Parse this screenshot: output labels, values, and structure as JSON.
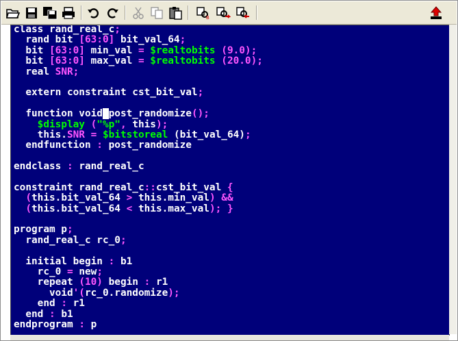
{
  "toolbar": {
    "buttons": [
      {
        "name": "open-file-button",
        "icon": "open-folder-icon"
      },
      {
        "name": "save-button",
        "icon": "floppy-disk-icon"
      },
      {
        "name": "save-all-button",
        "icon": "save-all-icon"
      },
      {
        "name": "print-button",
        "icon": "printer-icon"
      },
      {
        "name": "undo-button",
        "icon": "undo-icon"
      },
      {
        "name": "redo-button",
        "icon": "redo-icon"
      },
      {
        "name": "cut-button",
        "icon": "scissors-icon"
      },
      {
        "name": "copy-button",
        "icon": "copy-icon"
      },
      {
        "name": "paste-button",
        "icon": "clipboard-icon"
      },
      {
        "name": "replace-button",
        "icon": "find-replace-icon"
      },
      {
        "name": "find-next-button",
        "icon": "find-next-icon"
      },
      {
        "name": "find-prev-button",
        "icon": "find-previous-icon"
      },
      {
        "name": "upload-button",
        "icon": "upload-arrow-icon"
      }
    ]
  },
  "editor": {
    "colors": {
      "background": "#00007a",
      "text": "#ffffff",
      "operator": "#ff55ff",
      "system_task": "#00ff00",
      "cursor": "#ffffff"
    },
    "lines": [
      [
        {
          "t": "class rand_real_c",
          "c": "kw"
        },
        {
          "t": ";",
          "c": "op"
        }
      ],
      [
        {
          "t": "  rand bit ",
          "c": "kw"
        },
        {
          "t": "[63:0]",
          "c": "op"
        },
        {
          "t": " bit_val_64",
          "c": "kw"
        },
        {
          "t": ";",
          "c": "op"
        }
      ],
      [
        {
          "t": "  bit ",
          "c": "kw"
        },
        {
          "t": "[63:0]",
          "c": "op"
        },
        {
          "t": " min_val ",
          "c": "kw"
        },
        {
          "t": "=",
          "c": "op"
        },
        {
          "t": " ",
          "c": "kw"
        },
        {
          "t": "$realtobits",
          "c": "sys"
        },
        {
          "t": " ",
          "c": "kw"
        },
        {
          "t": "(9.0);",
          "c": "op"
        }
      ],
      [
        {
          "t": "  bit ",
          "c": "kw"
        },
        {
          "t": "[63:0]",
          "c": "op"
        },
        {
          "t": " max_val ",
          "c": "kw"
        },
        {
          "t": "=",
          "c": "op"
        },
        {
          "t": " ",
          "c": "kw"
        },
        {
          "t": "$realtobits",
          "c": "sys"
        },
        {
          "t": " ",
          "c": "kw"
        },
        {
          "t": "(20.0);",
          "c": "op"
        }
      ],
      [
        {
          "t": "  real ",
          "c": "kw"
        },
        {
          "t": "SNR;",
          "c": "op"
        }
      ],
      [
        {
          "t": "",
          "c": "kw"
        }
      ],
      [
        {
          "t": "  extern constraint cst_bit_val",
          "c": "kw"
        },
        {
          "t": ";",
          "c": "op"
        }
      ],
      [
        {
          "t": "",
          "c": "kw"
        }
      ],
      [
        {
          "t": "  function void",
          "c": "kw"
        },
        {
          "t": " ",
          "c": "cursor"
        },
        {
          "t": "post_randomize",
          "c": "kw"
        },
        {
          "t": "();",
          "c": "op"
        }
      ],
      [
        {
          "t": "    ",
          "c": "kw"
        },
        {
          "t": "$display",
          "c": "sys"
        },
        {
          "t": " (",
          "c": "op"
        },
        {
          "t": "\"%p\"",
          "c": "str"
        },
        {
          "t": ", ",
          "c": "op"
        },
        {
          "t": "this",
          "c": "kw"
        },
        {
          "t": ");",
          "c": "op"
        }
      ],
      [
        {
          "t": "    this.",
          "c": "kw"
        },
        {
          "t": "SNR",
          "c": "op"
        },
        {
          "t": " ",
          "c": "kw"
        },
        {
          "t": "=",
          "c": "op"
        },
        {
          "t": " ",
          "c": "kw"
        },
        {
          "t": "$bitstoreal",
          "c": "sys"
        },
        {
          "t": " (bit_val_64)",
          "c": "kw"
        },
        {
          "t": ";",
          "c": "op"
        }
      ],
      [
        {
          "t": "  endfunction ",
          "c": "kw"
        },
        {
          "t": ":",
          "c": "op"
        },
        {
          "t": " post_randomize",
          "c": "kw"
        }
      ],
      [
        {
          "t": "",
          "c": "kw"
        }
      ],
      [
        {
          "t": "endclass ",
          "c": "kw"
        },
        {
          "t": ":",
          "c": "op"
        },
        {
          "t": " rand_real_c",
          "c": "kw"
        }
      ],
      [
        {
          "t": "",
          "c": "kw"
        }
      ],
      [
        {
          "t": "constraint rand_real_c",
          "c": "kw"
        },
        {
          "t": "::",
          "c": "op"
        },
        {
          "t": "cst_bit_val ",
          "c": "kw"
        },
        {
          "t": "{",
          "c": "op"
        }
      ],
      [
        {
          "t": "  (",
          "c": "op"
        },
        {
          "t": "this.bit_val_64 ",
          "c": "kw"
        },
        {
          "t": ">",
          "c": "op"
        },
        {
          "t": " this.min_val",
          "c": "kw"
        },
        {
          "t": ")",
          "c": "op"
        },
        {
          "t": " ",
          "c": "kw"
        },
        {
          "t": "&&",
          "c": "op"
        }
      ],
      [
        {
          "t": "  (",
          "c": "op"
        },
        {
          "t": "this.bit_val_64 ",
          "c": "kw"
        },
        {
          "t": "<",
          "c": "op"
        },
        {
          "t": " this.max_val",
          "c": "kw"
        },
        {
          "t": ");",
          "c": "op"
        },
        {
          "t": " ",
          "c": "kw"
        },
        {
          "t": "}",
          "c": "op"
        }
      ],
      [
        {
          "t": "",
          "c": "kw"
        }
      ],
      [
        {
          "t": "program p",
          "c": "kw"
        },
        {
          "t": ";",
          "c": "op"
        }
      ],
      [
        {
          "t": "  rand_real_c rc_0",
          "c": "kw"
        },
        {
          "t": ";",
          "c": "op"
        }
      ],
      [
        {
          "t": "",
          "c": "kw"
        }
      ],
      [
        {
          "t": "  initial begin ",
          "c": "kw"
        },
        {
          "t": ":",
          "c": "op"
        },
        {
          "t": " b1",
          "c": "kw"
        }
      ],
      [
        {
          "t": "    rc_0 ",
          "c": "kw"
        },
        {
          "t": "=",
          "c": "op"
        },
        {
          "t": " new",
          "c": "kw"
        },
        {
          "t": ";",
          "c": "op"
        }
      ],
      [
        {
          "t": "    repeat ",
          "c": "kw"
        },
        {
          "t": "(10)",
          "c": "op"
        },
        {
          "t": " begin ",
          "c": "kw"
        },
        {
          "t": ":",
          "c": "op"
        },
        {
          "t": " r1",
          "c": "kw"
        }
      ],
      [
        {
          "t": "      void",
          "c": "kw"
        },
        {
          "t": "'(",
          "c": "op"
        },
        {
          "t": "rc_0.randomize",
          "c": "kw"
        },
        {
          "t": ");",
          "c": "op"
        }
      ],
      [
        {
          "t": "    end ",
          "c": "kw"
        },
        {
          "t": ":",
          "c": "op"
        },
        {
          "t": " r1",
          "c": "kw"
        }
      ],
      [
        {
          "t": "  end ",
          "c": "kw"
        },
        {
          "t": ":",
          "c": "op"
        },
        {
          "t": " b1",
          "c": "kw"
        }
      ],
      [
        {
          "t": "endprogram ",
          "c": "kw"
        },
        {
          "t": ":",
          "c": "op"
        },
        {
          "t": " p",
          "c": "kw"
        }
      ]
    ]
  }
}
